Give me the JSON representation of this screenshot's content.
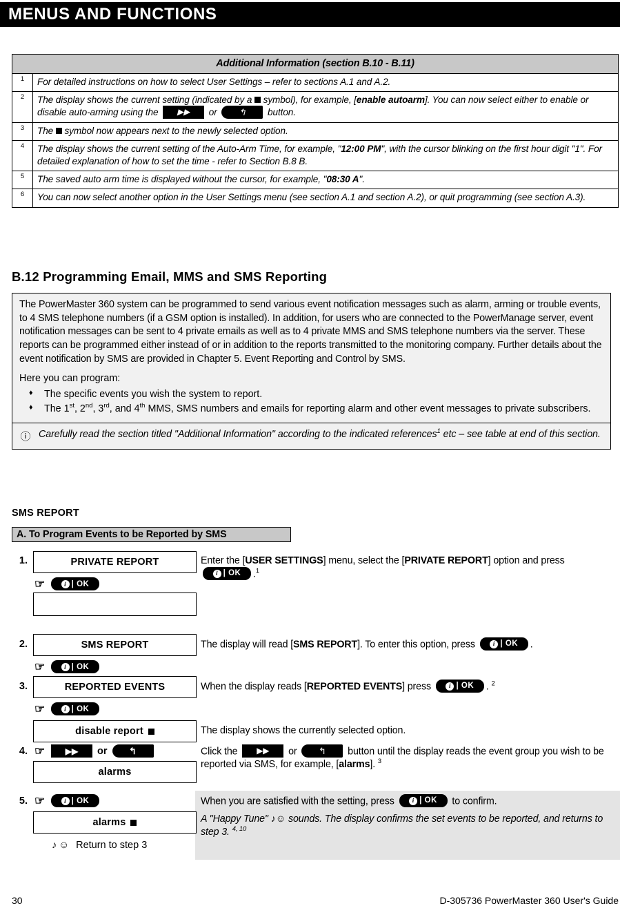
{
  "banner": {
    "title": "MENUS AND FUNCTIONS"
  },
  "additional_info": {
    "header": "Additional Information (section B.10 - B.11)",
    "rows": [
      {
        "num": "1",
        "text": "For detailed instructions on how to select User Settings – refer to sections A.1 and A.2."
      },
      {
        "num": "2",
        "text_a": "The display shows the current setting (indicated by a ",
        "text_b": " symbol), for example, [",
        "emph": "enable autoarm",
        "text_c": "]. You can now select either to enable or disable auto-arming using the ",
        "text_d": " or ",
        "text_e": " button."
      },
      {
        "num": "3",
        "text_a": "The ",
        "text_b": " symbol now appears next to the newly selected option."
      },
      {
        "num": "4",
        "text_a": "The display shows the current setting of the Auto-Arm Time, for example, \"",
        "emph": "12:00 PM",
        "text_b": "\", with the cursor blinking on the first hour digit \"1\". For detailed explanation of how to set the time - refer to Section B.8 B."
      },
      {
        "num": "5",
        "text_a": "The saved auto arm time is displayed without the cursor, for example, \"",
        "emph": "08:30 A",
        "text_b": "\"."
      },
      {
        "num": "6",
        "text": "You can now select another option in the User Settings menu (see section A.1 and section A.2), or quit programming (see section A.3)."
      }
    ]
  },
  "section": {
    "heading": "B.12 Programming Email, MMS and SMS Reporting",
    "intro_paragraph": "The PowerMaster 360 system can be programmed to send various event notification messages such as alarm, arming or trouble events, to 4 SMS telephone numbers (if a GSM option is installed). In addition, for users who are connected to the PowerManage server, event notification messages can be sent to 4 private emails as well as to 4 private MMS and SMS telephone numbers via the server. These reports can be programmed either instead of or in addition to the reports transmitted to the monitoring company. Further details about the event notification by SMS are provided in Chapter 5. Event Reporting and Control by SMS.",
    "here_you_can_program": "Here you can program:",
    "bullets": [
      {
        "text": "The specific events you wish the system to report."
      },
      {
        "prefix": "The 1",
        "sup1": "st",
        "mid1": ", 2",
        "sup2": "nd",
        "mid2": ", 3",
        "sup3": "rd",
        "mid3": ", and 4",
        "sup4": "th",
        "suffix": " MMS, SMS numbers and emails for reporting alarm and other event messages to private subscribers."
      }
    ],
    "note": {
      "icon": "info-icon",
      "text_a": "Carefully read the section titled \"Additional Information\" according to the indicated references",
      "sup": "1",
      "text_b": " etc – see table at end of this section."
    }
  },
  "sms_report": {
    "heading": "SMS REPORT",
    "subheading": "A. To Program Events to be Reported by SMS",
    "steps": [
      {
        "num": "1.",
        "display": "PRIVATE REPORT",
        "key": "ok",
        "narrative_a": "Enter the [",
        "narrative_b": "USER SETTINGS",
        "narrative_c": "] menu, select the [",
        "narrative_d": "PRIVATE REPORT",
        "narrative_e": "] option and press ",
        "narrative_f": ".",
        "ref": "1"
      },
      {
        "num": "2.",
        "display": "SMS REPORT",
        "key": "ok",
        "narrative_a": "The display will read [",
        "narrative_b": "SMS REPORT",
        "narrative_c": "]. To enter this option, press ",
        "narrative_d": "."
      },
      {
        "num": "3.",
        "display": "REPORTED EVENTS",
        "key": "ok",
        "narrative_a": "When the display reads [",
        "narrative_b": "REPORTED EVENTS",
        "narrative_c": "] press ",
        "narrative_d": ".",
        "ref": "2",
        "display2": "disable report",
        "display2_marker": true,
        "narrative2": "The display shows the currently selected option."
      },
      {
        "num": "4.",
        "keys": "next-or-back",
        "or_label": "or",
        "display": "alarms",
        "narrative_a": "Click the ",
        "narrative_b": " or ",
        "narrative_c": " button until the display reads the event group you wish to be reported via SMS, for example, [",
        "narrative_d": "alarms",
        "narrative_e": "].",
        "ref": "3"
      },
      {
        "num": "5.",
        "key": "ok",
        "narrative_a": "When you are satisfied with the setting, press ",
        "narrative_b": " to confirm.",
        "display": "alarms",
        "display_marker": true,
        "return_label": "Return to step 3",
        "confirm_a": "A \"Happy Tune\" ",
        "confirm_b": " sounds. The display confirms the set events to be reported, and returns to step 3.",
        "confirm_ref": "4, 10"
      }
    ]
  },
  "footer": {
    "page_number": "30",
    "guide": "D-305736 PowerMaster 360 User's Guide"
  },
  "glyphs": {
    "hand": "☞",
    "info": "i",
    "ok": "OK",
    "next": "▶▶",
    "back": "↰",
    "note": "ⓘ",
    "music": "♪",
    "smiley": "☺",
    "diamond": "♦",
    "square": "■"
  }
}
